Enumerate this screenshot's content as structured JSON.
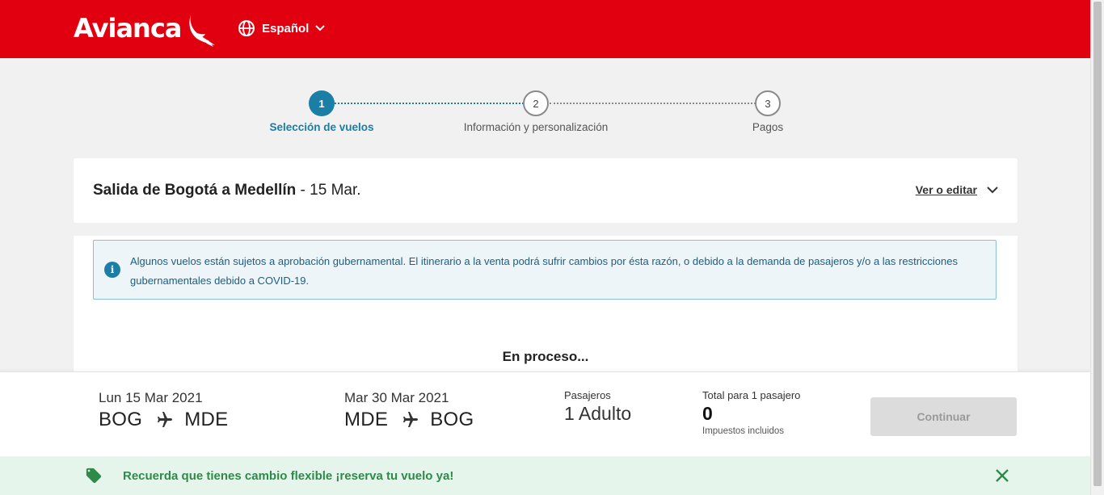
{
  "header": {
    "brand": "Avianca",
    "language_label": "Español",
    "colors": {
      "brand_red": "#e1000f"
    }
  },
  "stepper": {
    "steps": [
      {
        "number": "1",
        "label": "Selección de vuelos",
        "state": "active"
      },
      {
        "number": "2",
        "label": "Información y personalización",
        "state": "pending"
      },
      {
        "number": "3",
        "label": "Pagos",
        "state": "pending"
      }
    ],
    "accent_color": "#1a7ea6"
  },
  "route": {
    "title_bold": "Salida de Bogotá a Medellín",
    "title_suffix": " - 15 Mar.",
    "edit_label": "Ver o editar"
  },
  "alert": {
    "text": "Algunos vuelos están sujetos a aprobación gubernamental. El itinerario a la venta podrá sufrir cambios por ésta razón, o debido a la demanda de pasajeros y/o a las restricciones gubernamentales debido a COVID-19."
  },
  "status": {
    "processing": "En proceso..."
  },
  "summary": {
    "outbound": {
      "date": "Lun 15 Mar 2021",
      "from": "BOG",
      "to": "MDE"
    },
    "return": {
      "date": "Mar 30 Mar 2021",
      "from": "MDE",
      "to": "BOG"
    },
    "passengers_label": "Pasajeros",
    "passengers_value": "1 Adulto",
    "total_label": "Total para 1 pasajero",
    "total_value": "0",
    "total_note": "Impuestos incluidos",
    "continue_label": "Continuar"
  },
  "promo": {
    "text": "Recuerda que tienes cambio flexible ¡reserva tu vuelo ya!",
    "color": "#2e8b47"
  }
}
